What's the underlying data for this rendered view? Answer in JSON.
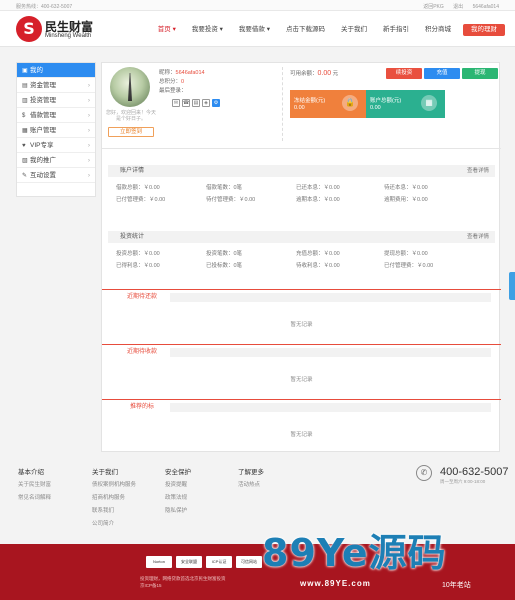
{
  "topbar": {
    "phone": "服务热线：400-632-5007",
    "links": [
      "返回PKG",
      "退出",
      "5646afa014"
    ]
  },
  "logo": {
    "mark": "S",
    "cn": "民生财富",
    "en": "Minsheng Wealth"
  },
  "nav": [
    "首页 ▾",
    "我要投资 ▾",
    "我要借款 ▾",
    "点击下载源码",
    "关于我们",
    "新手指引",
    "积分商城"
  ],
  "nav_cta": "我的理财",
  "sidebar": [
    {
      "label": "我的",
      "icon": "▣",
      "arrow": ""
    },
    {
      "label": "资金管理",
      "icon": "▤",
      "arrow": "›"
    },
    {
      "label": "投资管理",
      "icon": "▥",
      "arrow": "›"
    },
    {
      "label": "借款管理",
      "icon": "$",
      "arrow": "›"
    },
    {
      "label": "账户管理",
      "icon": "▦",
      "arrow": "›"
    },
    {
      "label": "VIP专享",
      "icon": "♥",
      "arrow": "›"
    },
    {
      "label": "我的推广",
      "icon": "▧",
      "arrow": "›"
    },
    {
      "label": "互动设置",
      "icon": "✎",
      "arrow": "›"
    }
  ],
  "profile": {
    "greeting": "您好，欢迎回来！今天是个好日子。",
    "sign": "立即签到",
    "nick_label": "昵称：",
    "nick": "5646afa014",
    "points_label": "总积分：",
    "points": "0",
    "last_login_label": "最后登录：",
    "badges": [
      "✉",
      "☎",
      "▤",
      "◈",
      "⚙"
    ]
  },
  "balance": {
    "label": "可用余额：",
    "value": "0.00",
    "unit": "元"
  },
  "actions": [
    {
      "label": "续投资",
      "color": "#e9503f"
    },
    {
      "label": "充值",
      "color": "#2d8cf0"
    },
    {
      "label": "提现",
      "color": "#2bb673"
    }
  ],
  "cards": [
    {
      "title": "冻结金额(元)",
      "value": "0.00",
      "color": "#f0803c",
      "icon": "🔒"
    },
    {
      "title": "账户总额(元)",
      "value": "0.00",
      "color": "#2bb090",
      "icon": "▦"
    }
  ],
  "account_detail": {
    "title": "账户详情",
    "more": "查看详情",
    "rows": [
      [
        "借款总额：￥0.00",
        "借款笔数：0笔",
        "已还本息：￥0.00",
        "待还本息：￥0.00"
      ],
      [
        "已付管理费：￥0.00",
        "待付管理费：￥0.00",
        "逾期本息：￥0.00",
        "逾期费用：￥0.00"
      ]
    ]
  },
  "invest_stats": {
    "title": "投资统计",
    "more": "查看详情",
    "rows": [
      [
        "投资总额：￥0.00",
        "投资笔数：0笔",
        "充值总额：￥0.00",
        "提现总额：￥0.00"
      ],
      [
        "已得利息：￥0.00",
        "已投标数：0笔",
        "待收利息：￥0.00",
        "已付管理费：￥0.00"
      ]
    ]
  },
  "lists": [
    {
      "title": "近期待还款",
      "empty": "暂无记录"
    },
    {
      "title": "近期待收款",
      "empty": "暂无记录"
    },
    {
      "title": "推荐的标",
      "empty": "暂无记录"
    }
  ],
  "footer": {
    "cols": [
      {
        "h": "基本介绍",
        "items": [
          "关于民生财富",
          "常见名词解释"
        ]
      },
      {
        "h": "关于我们",
        "items": [
          "债权案例机构服务",
          "招商机构服务",
          "联系我们",
          "公司简介"
        ]
      },
      {
        "h": "安全保护",
        "items": [
          "投资提醒",
          "政策法规",
          "隐私保护"
        ]
      },
      {
        "h": "了解更多",
        "items": [
          "活动热点"
        ]
      }
    ],
    "phone": "400-632-5007",
    "phone_sub": "周一至周六 9:00-18:00",
    "certs": [
      "Norton",
      "安全联盟",
      "ICP认证",
      "可信网站"
    ],
    "text1": "投资理财，网络贷款首选北京民生财富投资",
    "text2": "京ICP备15"
  },
  "watermark": {
    "main": "89Ye源码",
    "url": "www.89YE.com",
    "tag": "10年老站"
  }
}
